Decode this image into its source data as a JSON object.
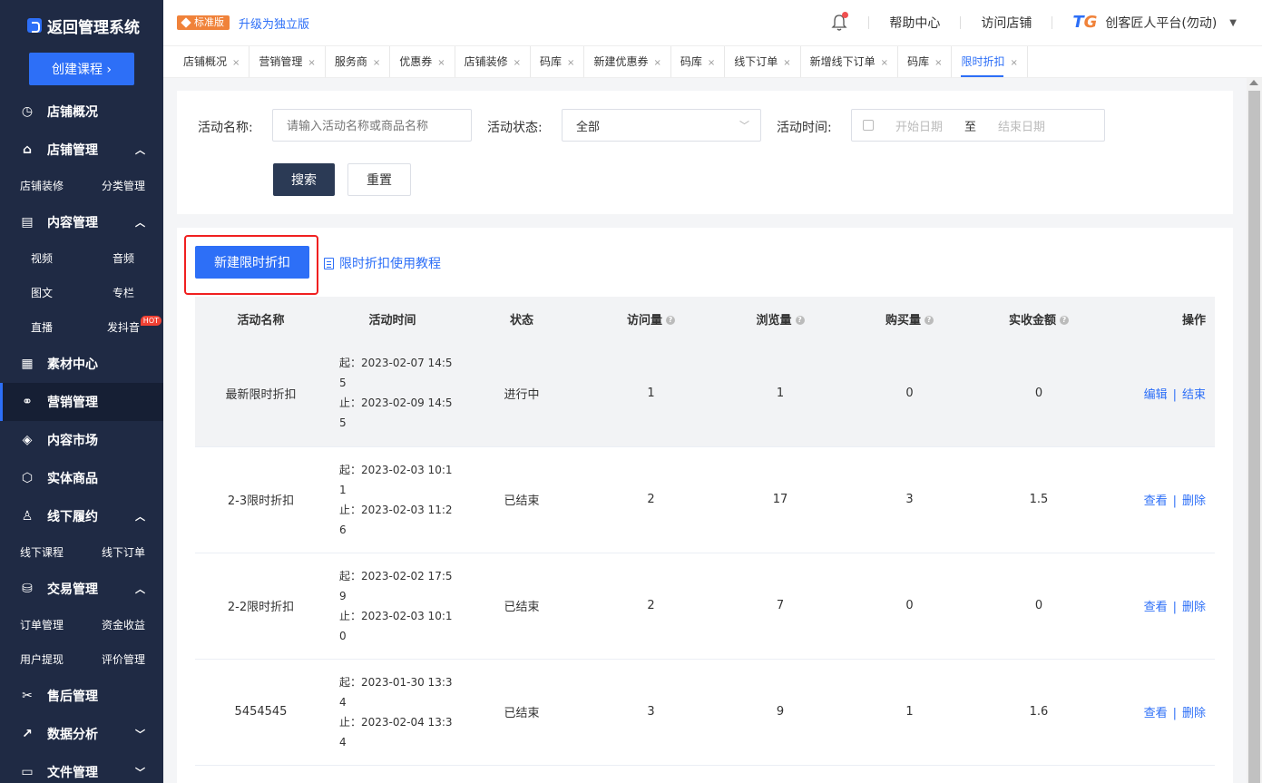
{
  "sidebar": {
    "brand": "返回管理系统",
    "create_button": "创建课程 ›",
    "menu": [
      {
        "label": "店铺概况",
        "icon": "clock-icon"
      },
      {
        "label": "店铺管理",
        "icon": "store-icon",
        "sub": [
          "店铺装修",
          "分类管理"
        ]
      },
      {
        "label": "内容管理",
        "icon": "book-icon",
        "sub": [
          "视频",
          "音频",
          "图文",
          "专栏",
          "直播",
          "发抖音"
        ]
      },
      {
        "label": "素材中心",
        "icon": "file-icon"
      },
      {
        "label": "营销管理",
        "icon": "share-icon"
      },
      {
        "label": "内容市场",
        "icon": "layers-icon"
      },
      {
        "label": "实体商品",
        "icon": "box-icon"
      },
      {
        "label": "线下履约",
        "icon": "user-icon",
        "sub": [
          "线下课程",
          "线下订单"
        ]
      },
      {
        "label": "交易管理",
        "icon": "cart-icon",
        "sub": [
          "订单管理",
          "资金收益",
          "用户提现",
          "评价管理"
        ]
      },
      {
        "label": "售后管理",
        "icon": "service-icon"
      },
      {
        "label": "数据分析",
        "icon": "chart-icon"
      },
      {
        "label": "文件管理",
        "icon": "folder-icon"
      }
    ],
    "hot_badge": "HOT"
  },
  "topbar": {
    "edition": "标准版",
    "upgrade": "升级为独立版",
    "help": "帮助中心",
    "visit_store": "访问店铺",
    "org_name": "创客匠人平台(勿动)"
  },
  "tabs": [
    "店铺概况",
    "营销管理",
    "服务商",
    "优惠券",
    "店铺装修",
    "码库",
    "新建优惠券",
    "码库",
    "线下订单",
    "新增线下订单",
    "码库",
    "限时折扣"
  ],
  "filter": {
    "name_label": "活动名称:",
    "name_placeholder": "请输入活动名称或商品名称",
    "status_label": "活动状态:",
    "status_value": "全部",
    "time_label": "活动时间:",
    "start_placeholder": "开始日期",
    "to": "至",
    "end_placeholder": "结束日期",
    "search": "搜索",
    "reset": "重置"
  },
  "list": {
    "new_button": "新建限时折扣",
    "tutorial": "限时折扣使用教程",
    "headers": [
      "活动名称",
      "活动时间",
      "状态",
      "访问量",
      "浏览量",
      "购买量",
      "实收金额",
      "操作"
    ],
    "rows": [
      {
        "name": "最新限时折扣",
        "start": "起：2023-02-07 14:55",
        "end": "止：2023-02-09 14:55",
        "status": "进行中",
        "visits": "1",
        "views": "1",
        "buys": "0",
        "amount": "0",
        "op1": "编辑",
        "op2": "结束"
      },
      {
        "name": "2-3限时折扣",
        "start": "起：2023-02-03 10:11",
        "end": "止：2023-02-03 11:26",
        "status": "已结束",
        "visits": "2",
        "views": "17",
        "buys": "3",
        "amount": "1.5",
        "op1": "查看",
        "op2": "删除"
      },
      {
        "name": "2-2限时折扣",
        "start": "起：2023-02-02 17:59",
        "end": "止：2023-02-03 10:10",
        "status": "已结束",
        "visits": "2",
        "views": "7",
        "buys": "0",
        "amount": "0",
        "op1": "查看",
        "op2": "删除"
      },
      {
        "name": "5454545",
        "start": "起：2023-01-30 13:34",
        "end": "止：2023-02-04 13:34",
        "status": "已结束",
        "visits": "3",
        "views": "9",
        "buys": "1",
        "amount": "1.6",
        "op1": "查看",
        "op2": "删除"
      }
    ]
  },
  "colors": {
    "sidebar_bg": "#1f2a44",
    "primary": "#2d6ff7",
    "highlight_border": "#f02020"
  }
}
